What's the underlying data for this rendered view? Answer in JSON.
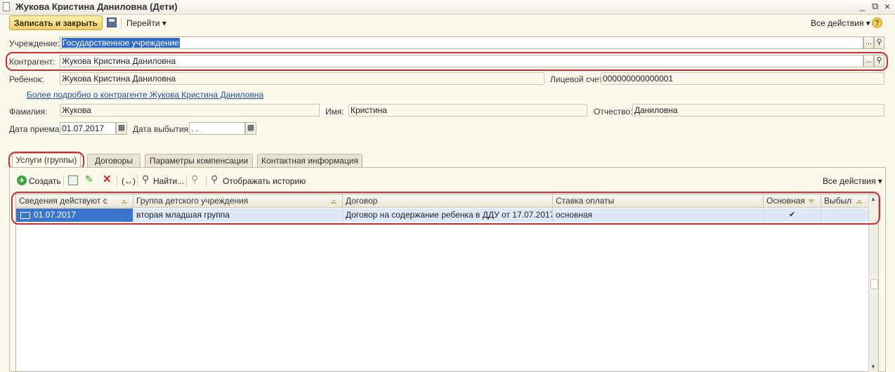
{
  "window": {
    "title": "Жукова Кристина  Даниловна (Дети)",
    "minimize": "_",
    "restore": "⧉",
    "close": "×"
  },
  "toolbar": {
    "save_close": "Записать и закрыть",
    "goto": "Перейти ▾",
    "all_actions": "Все действия ▾",
    "help": "?"
  },
  "form": {
    "institution_label": "Учреждение:",
    "institution_value": "Государственное учреждение",
    "counterparty_label": "Контрагент:",
    "counterparty_value": "Жукова Кристина Даниловна",
    "child_label": "Ребенок:",
    "child_value": "Жукова Кристина  Даниловна",
    "account_label": "Лицевой счет:",
    "account_value": "000000000000001",
    "more_link": "Более подробно о контрагенте Жукова Кристина Даниловна",
    "surname_label": "Фамилия:",
    "surname_value": "Жукова",
    "name_label": "Имя:",
    "name_value": "Кристина",
    "patronymic_label": "Отчество:",
    "patronymic_value": "Даниловна",
    "admission_label": "Дата приема:",
    "admission_value": "01.07.2017",
    "leave_label": "Дата выбытия:",
    "leave_value": " .  ."
  },
  "tabs": [
    "Услуги (группы)",
    "Договоры",
    "Параметры компенсации",
    "Контактная информация"
  ],
  "grid_toolbar": {
    "create": "Создать",
    "find": "Найти...",
    "history": "Отображать историю",
    "all_actions": "Все действия ▾",
    "range": "(↔)"
  },
  "table": {
    "headers": [
      "Сведения действуют с",
      "Группа детского учреждения",
      "Договор",
      "Ставка оплаты",
      "Основная",
      "Выбыл"
    ],
    "rows": [
      [
        "01.07.2017",
        "вторая младшая группа",
        "Договор на содержание ребенка в ДДУ  от 17.07.2017",
        "основная",
        "✔",
        ""
      ]
    ]
  },
  "colors": {
    "highlight": "#d42b35",
    "selection": "#3169c6",
    "background": "#fbf9ec"
  }
}
